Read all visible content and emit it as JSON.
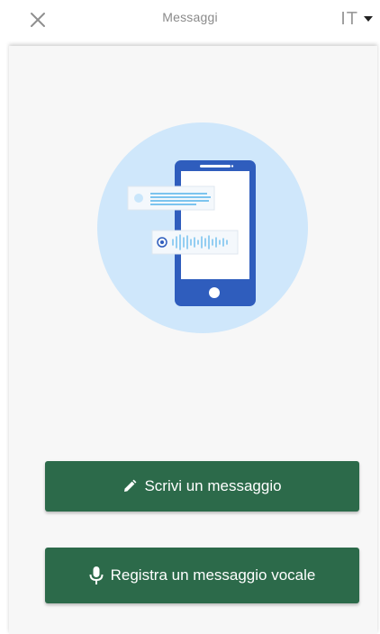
{
  "header": {
    "title": "Messaggi",
    "language": "IT",
    "close_icon": "close-icon",
    "caret_icon": "caret-down-icon"
  },
  "illustration": {
    "icon": "phone-messages-illustration"
  },
  "actions": {
    "write_label": "Scrivi un messaggio",
    "write_icon": "pencil-icon",
    "voice_label": "Registra un messaggio vocale",
    "voice_icon": "microphone-icon"
  },
  "colors": {
    "button_bg": "#2c6a4a",
    "circle_bg": "#cfe7fb",
    "phone_body": "#2f5dbd"
  }
}
